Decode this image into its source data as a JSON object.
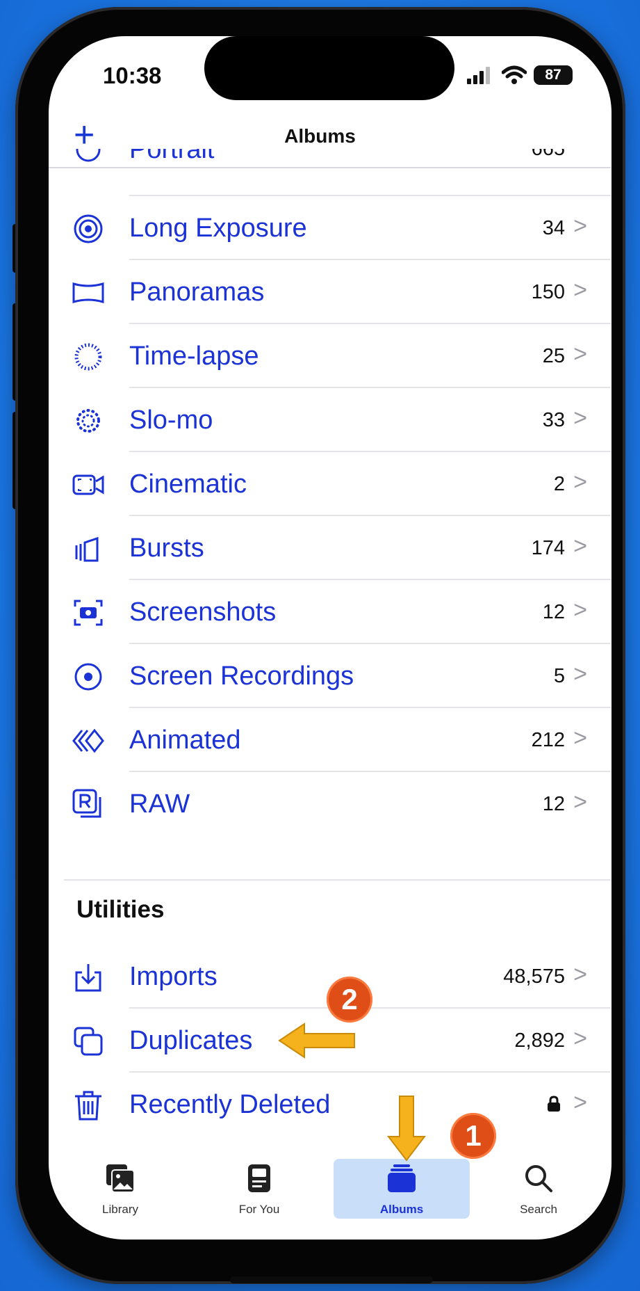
{
  "status_bar": {
    "time": "10:38",
    "battery": "87"
  },
  "nav": {
    "title": "Albums",
    "add_label": "+"
  },
  "partial_row": {
    "label": "Portrait",
    "count": "665"
  },
  "albums": [
    {
      "label": "Long Exposure",
      "count": "34",
      "icon": "long-exposure-icon"
    },
    {
      "label": "Panoramas",
      "count": "150",
      "icon": "panorama-icon"
    },
    {
      "label": "Time-lapse",
      "count": "25",
      "icon": "timelapse-icon"
    },
    {
      "label": "Slo-mo",
      "count": "33",
      "icon": "slomo-icon"
    },
    {
      "label": "Cinematic",
      "count": "2",
      "icon": "cinematic-icon"
    },
    {
      "label": "Bursts",
      "count": "174",
      "icon": "bursts-icon"
    },
    {
      "label": "Screenshots",
      "count": "12",
      "icon": "screenshot-icon"
    },
    {
      "label": "Screen Recordings",
      "count": "5",
      "icon": "screen-recording-icon"
    },
    {
      "label": "Animated",
      "count": "212",
      "icon": "animated-icon"
    },
    {
      "label": "RAW",
      "count": "12",
      "icon": "raw-icon"
    }
  ],
  "utilities": {
    "title": "Utilities",
    "items": [
      {
        "label": "Imports",
        "count": "48,575",
        "icon": "import-icon"
      },
      {
        "label": "Duplicates",
        "count": "2,892",
        "icon": "duplicates-icon"
      },
      {
        "label": "Recently Deleted",
        "count": "",
        "icon": "lock-icon"
      }
    ]
  },
  "chevron": ">",
  "tabs": [
    {
      "label": "Library",
      "icon": "library-icon",
      "selected": false
    },
    {
      "label": "For You",
      "icon": "for-you-icon",
      "selected": false
    },
    {
      "label": "Albums",
      "icon": "albums-icon",
      "selected": true
    },
    {
      "label": "Search",
      "icon": "search-icon",
      "selected": false
    }
  ],
  "annotations": {
    "badge_1": "1",
    "badge_2": "2"
  },
  "colors": {
    "accent": "#1a32d6",
    "background": "#1d7fea",
    "badge": "#e04e17",
    "arrow": "#f5b21c"
  }
}
